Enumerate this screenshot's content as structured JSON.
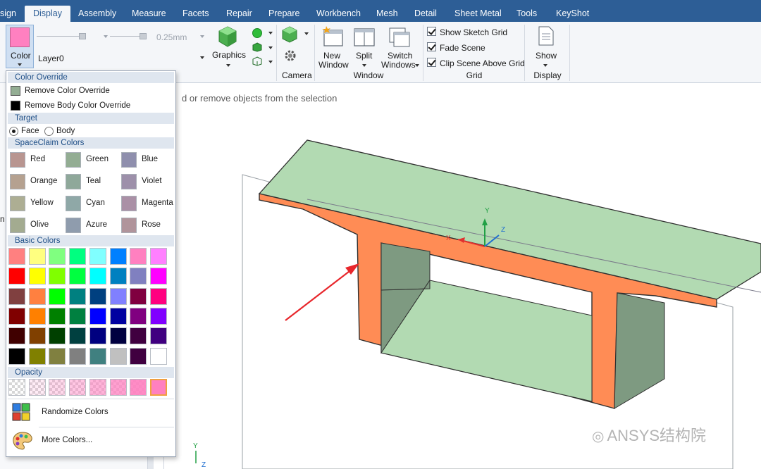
{
  "tabs": [
    "sign",
    "Display",
    "Assembly",
    "Measure",
    "Facets",
    "Repair",
    "Prepare",
    "Workbench",
    "Mesh",
    "Detail",
    "Sheet Metal",
    "Tools",
    "KeyShot"
  ],
  "active_tab": "Display",
  "ribbon": {
    "color_button": "Color",
    "layer": "Layer0",
    "line_width": "0.25mm",
    "graphics": "Graphics",
    "camera": "Camera",
    "new_window": "New Window",
    "new_window_l1": "New",
    "new_window_l2": "Window",
    "split": "Split",
    "switch_windows_l1": "Switch",
    "switch_windows_l2": "Windows",
    "window_group": "Window",
    "show_sketch_grid": "Show Sketch Grid",
    "fade_scene": "Fade Scene",
    "clip_scene": "Clip Scene Above Grid",
    "grid_group": "Grid",
    "show": "Show",
    "display_group": "Display"
  },
  "viewport": {
    "hint": "d or remove objects from the selection",
    "left_edge_char": "n",
    "axes": {
      "x": "X",
      "y": "Y",
      "z": "Z"
    }
  },
  "dropdown": {
    "color_override": "Color Override",
    "remove_color_override": "Remove Color Override",
    "remove_body_color_override": "Remove Body Color Override",
    "target": "Target",
    "face": "Face",
    "body": "Body",
    "spaceclaim_colors": "SpaceClaim Colors",
    "named_colors": [
      {
        "name": "Red",
        "color": "#b89590"
      },
      {
        "name": "Green",
        "color": "#93ad93"
      },
      {
        "name": "Blue",
        "color": "#8f8fad"
      },
      {
        "name": "Orange",
        "color": "#b5a190"
      },
      {
        "name": "Teal",
        "color": "#8fa89a"
      },
      {
        "name": "Violet",
        "color": "#9d90aa"
      },
      {
        "name": "Yellow",
        "color": "#adae93"
      },
      {
        "name": "Cyan",
        "color": "#8fa8a7"
      },
      {
        "name": "Magenta",
        "color": "#aa90a6"
      },
      {
        "name": "Olive",
        "color": "#a3ab90"
      },
      {
        "name": "Azure",
        "color": "#8f9cad"
      },
      {
        "name": "Rose",
        "color": "#b0949b"
      }
    ],
    "basic_colors_label": "Basic Colors",
    "basic_colors": [
      "#ff8080",
      "#ffff80",
      "#80ff80",
      "#00ff80",
      "#80ffff",
      "#0080ff",
      "#ff80c0",
      "#ff80ff",
      "#ff0000",
      "#ffff00",
      "#80ff00",
      "#00ff40",
      "#00ffff",
      "#0080c0",
      "#8080c0",
      "#ff00ff",
      "#804040",
      "#ff8040",
      "#00ff00",
      "#008080",
      "#004080",
      "#8080ff",
      "#800040",
      "#ff0080",
      "#800000",
      "#ff8000",
      "#008000",
      "#008040",
      "#0000ff",
      "#0000a0",
      "#800080",
      "#8000ff",
      "#400000",
      "#804000",
      "#004000",
      "#004040",
      "#000080",
      "#000040",
      "#400040",
      "#400080",
      "#000000",
      "#808000",
      "#808040",
      "#808080",
      "#408080",
      "#c0c0c0",
      "#400040",
      "#ffffff"
    ],
    "opacity_label": "Opacity",
    "opacity_levels": [
      0,
      0.15,
      0.3,
      0.45,
      0.6,
      0.75,
      0.9,
      1.0
    ],
    "randomize": "Randomize Colors",
    "more_colors": "More Colors..."
  },
  "watermark": "ANSYS结构院",
  "colors": {
    "accent": "#2d5e96",
    "section_orange": "#ff8c55",
    "flange_green": "#b2dab2",
    "selected_color": "#ff80c0",
    "arrow_red": "#e8262b"
  }
}
